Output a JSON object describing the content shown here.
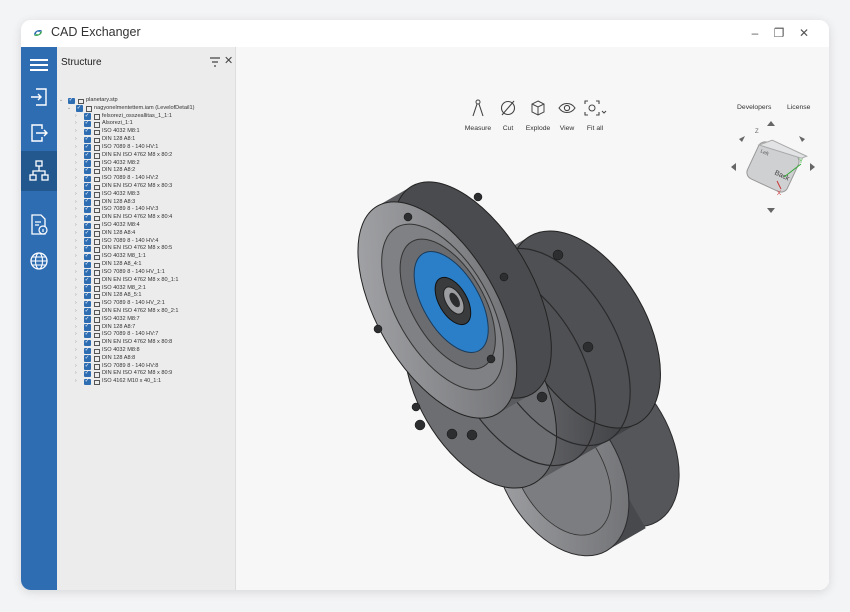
{
  "app": {
    "title": "CAD Exchanger"
  },
  "window_controls": {
    "minimize": "–",
    "restore": "❐",
    "close": "✕"
  },
  "panel": {
    "title": "Structure",
    "close": "✕"
  },
  "tree": {
    "root": "planetary.stp",
    "assembly": "nagyonelmentettem.iam (LevelofDetail1)",
    "items": [
      "felsorezi_osszeallitas_1_1:1",
      "Alsorezi_1:1",
      "ISO 4032 M8:1",
      "DIN 128 A8:1",
      "ISO 7089 8 - 140 HV:1",
      "DIN EN ISO 4762 M8 x 80:2",
      "ISO 4032 M8:2",
      "DIN 128 A8:2",
      "ISO 7089 8 - 140 HV:2",
      "DIN EN ISO 4762 M8 x 80:3",
      "ISO 4032 M8:3",
      "DIN 128 A8:3",
      "ISO 7089 8 - 140 HV:3",
      "DIN EN ISO 4762 M8 x 80:4",
      "ISO 4032 M8:4",
      "DIN 128 A8:4",
      "ISO 7089 8 - 140 HV:4",
      "DIN EN ISO 4762 M8 x 80:5",
      "ISO 4032 M8_1:1",
      "DIN 128 A8_4:1",
      "ISO 7089 8 - 140 HV_1:1",
      "DIN EN ISO 4762 M8 x 80_1:1",
      "ISO 4032 M8_2:1",
      "DIN 128 A8_5:1",
      "ISO 7089 8 - 140 HV_2:1",
      "DIN EN ISO 4762 M8 x 80_2:1",
      "ISO 4032 M8:7",
      "DIN 128 A8:7",
      "ISO 7089 8 - 140 HV:7",
      "DIN EN ISO 4762 M8 x 80:8",
      "ISO 4032 M8:8",
      "DIN 128 A8:8",
      "ISO 7089 8 - 140 HV:8",
      "DIN EN ISO 4762 M8 x 80:9",
      "ISO 4162 M10 x 40_1:1"
    ]
  },
  "toolbar": {
    "measure": "Measure",
    "cut": "Cut",
    "explode": "Explode",
    "view": "View",
    "fit_all": "Fit all"
  },
  "links": {
    "developers": "Developers",
    "license": "License"
  },
  "viewcube": {
    "face_back": "Back",
    "face_side": "Left",
    "axis_z": "Z",
    "axis_x": "X",
    "axis_y": "Y"
  },
  "colors": {
    "accent": "#2f6db3",
    "accent_dark": "#23588f",
    "model_gray": "#6f7073",
    "model_blue": "#2a7fc8"
  }
}
